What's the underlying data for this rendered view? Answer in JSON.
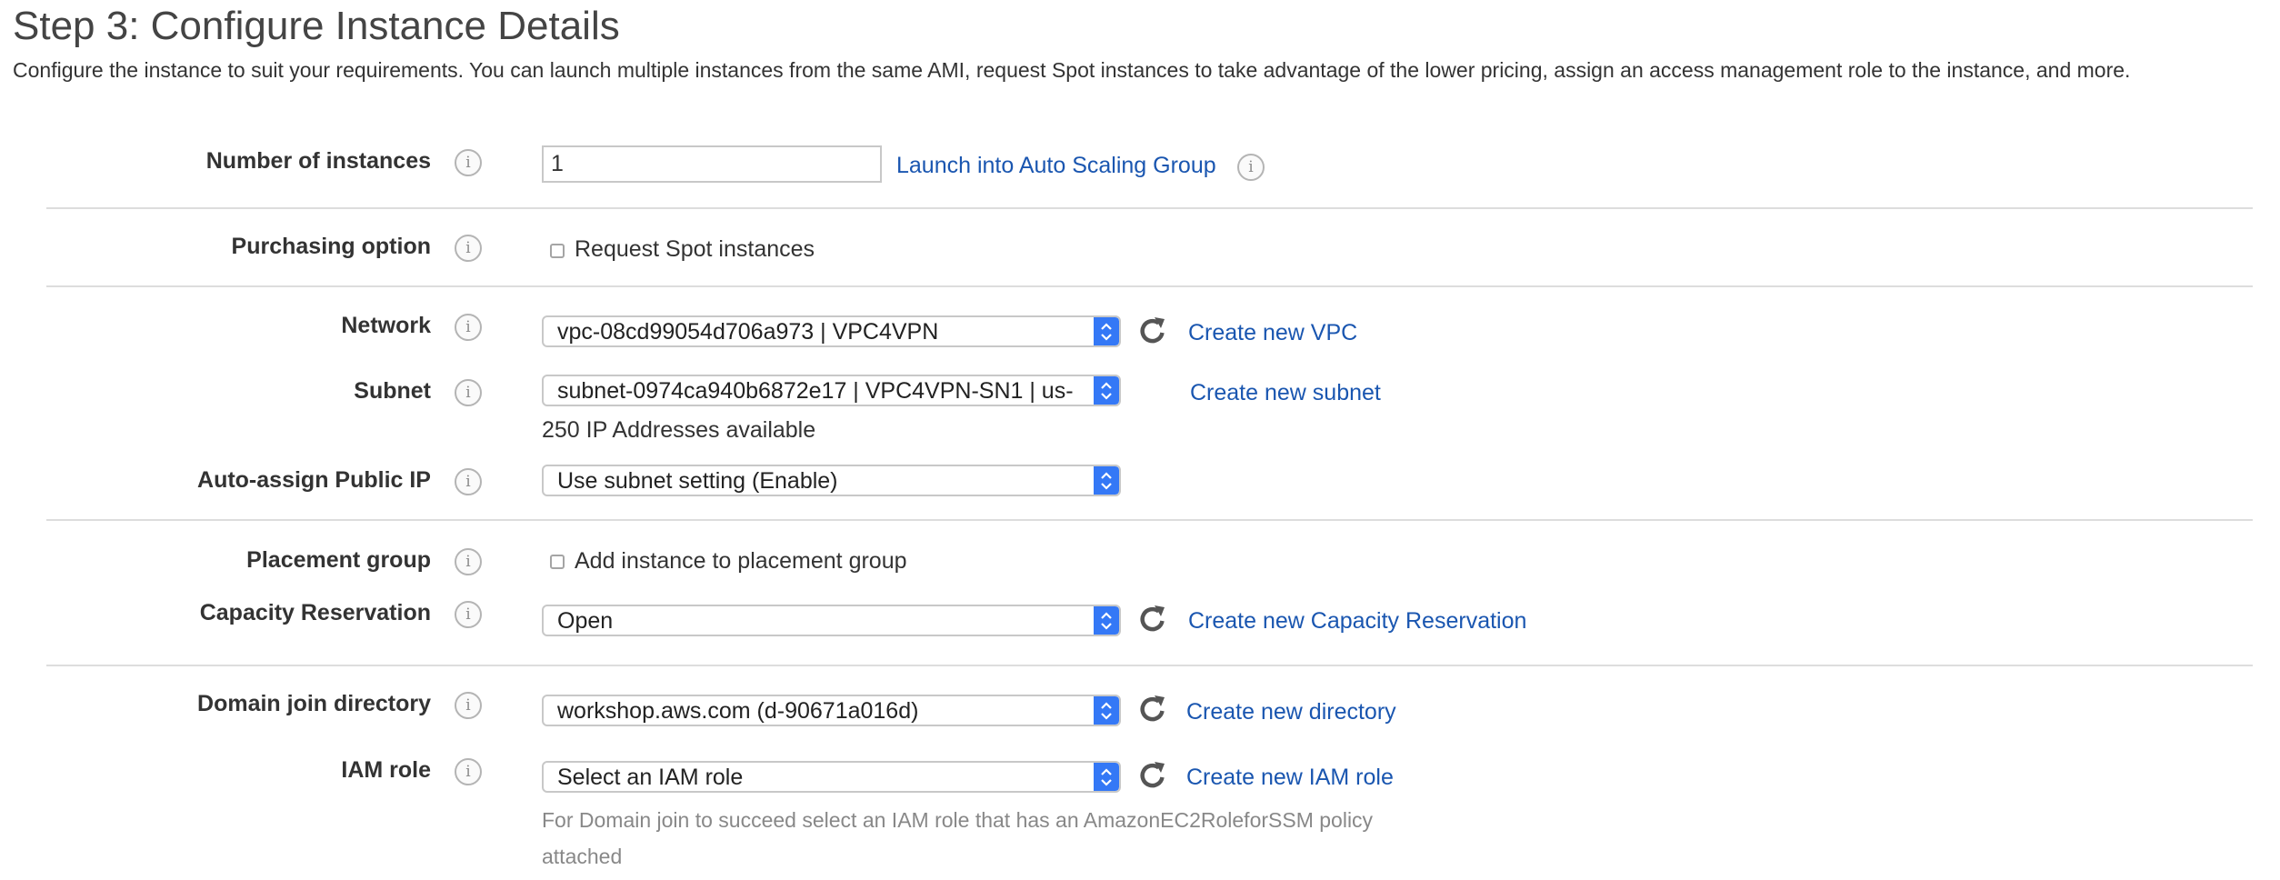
{
  "page": {
    "title": "Step 3: Configure Instance Details",
    "description": "Configure the instance to suit your requirements. You can launch multiple instances from the same AMI, request Spot instances to take advantage of the lower pricing, assign an access management role to the instance, and more."
  },
  "form": {
    "number_of_instances": {
      "label": "Number of instances",
      "value": "1",
      "link": "Launch into Auto Scaling Group"
    },
    "purchasing_option": {
      "label": "Purchasing option",
      "checkbox_label": "Request Spot instances",
      "checked": false
    },
    "network": {
      "label": "Network",
      "value": "vpc-08cd99054d706a973 | VPC4VPN",
      "link": "Create new VPC"
    },
    "subnet": {
      "label": "Subnet",
      "value": "subnet-0974ca940b6872e17 | VPC4VPN-SN1 | us-",
      "link": "Create new subnet",
      "note": "250 IP Addresses available"
    },
    "auto_assign_public_ip": {
      "label": "Auto-assign Public IP",
      "value": "Use subnet setting (Enable)"
    },
    "placement_group": {
      "label": "Placement group",
      "checkbox_label": "Add instance to placement group",
      "checked": false
    },
    "capacity_reservation": {
      "label": "Capacity Reservation",
      "value": "Open",
      "link": "Create new Capacity Reservation"
    },
    "domain_join_directory": {
      "label": "Domain join directory",
      "value": "workshop.aws.com (d-90671a016d)",
      "link": "Create new directory"
    },
    "iam_role": {
      "label": "IAM role",
      "value": "Select an IAM role",
      "link": "Create new IAM role",
      "hint": "For Domain join to succeed select an IAM role that has an AmazonEC2RoleforSSM policy attached"
    }
  },
  "icons": {
    "info": "info-icon",
    "refresh": "refresh-icon",
    "select_arrows": "chevron-up-down-icon"
  },
  "colors": {
    "link": "#1a56b0",
    "select_button": "#3478f6",
    "label": "#333333",
    "hint": "#888888"
  }
}
